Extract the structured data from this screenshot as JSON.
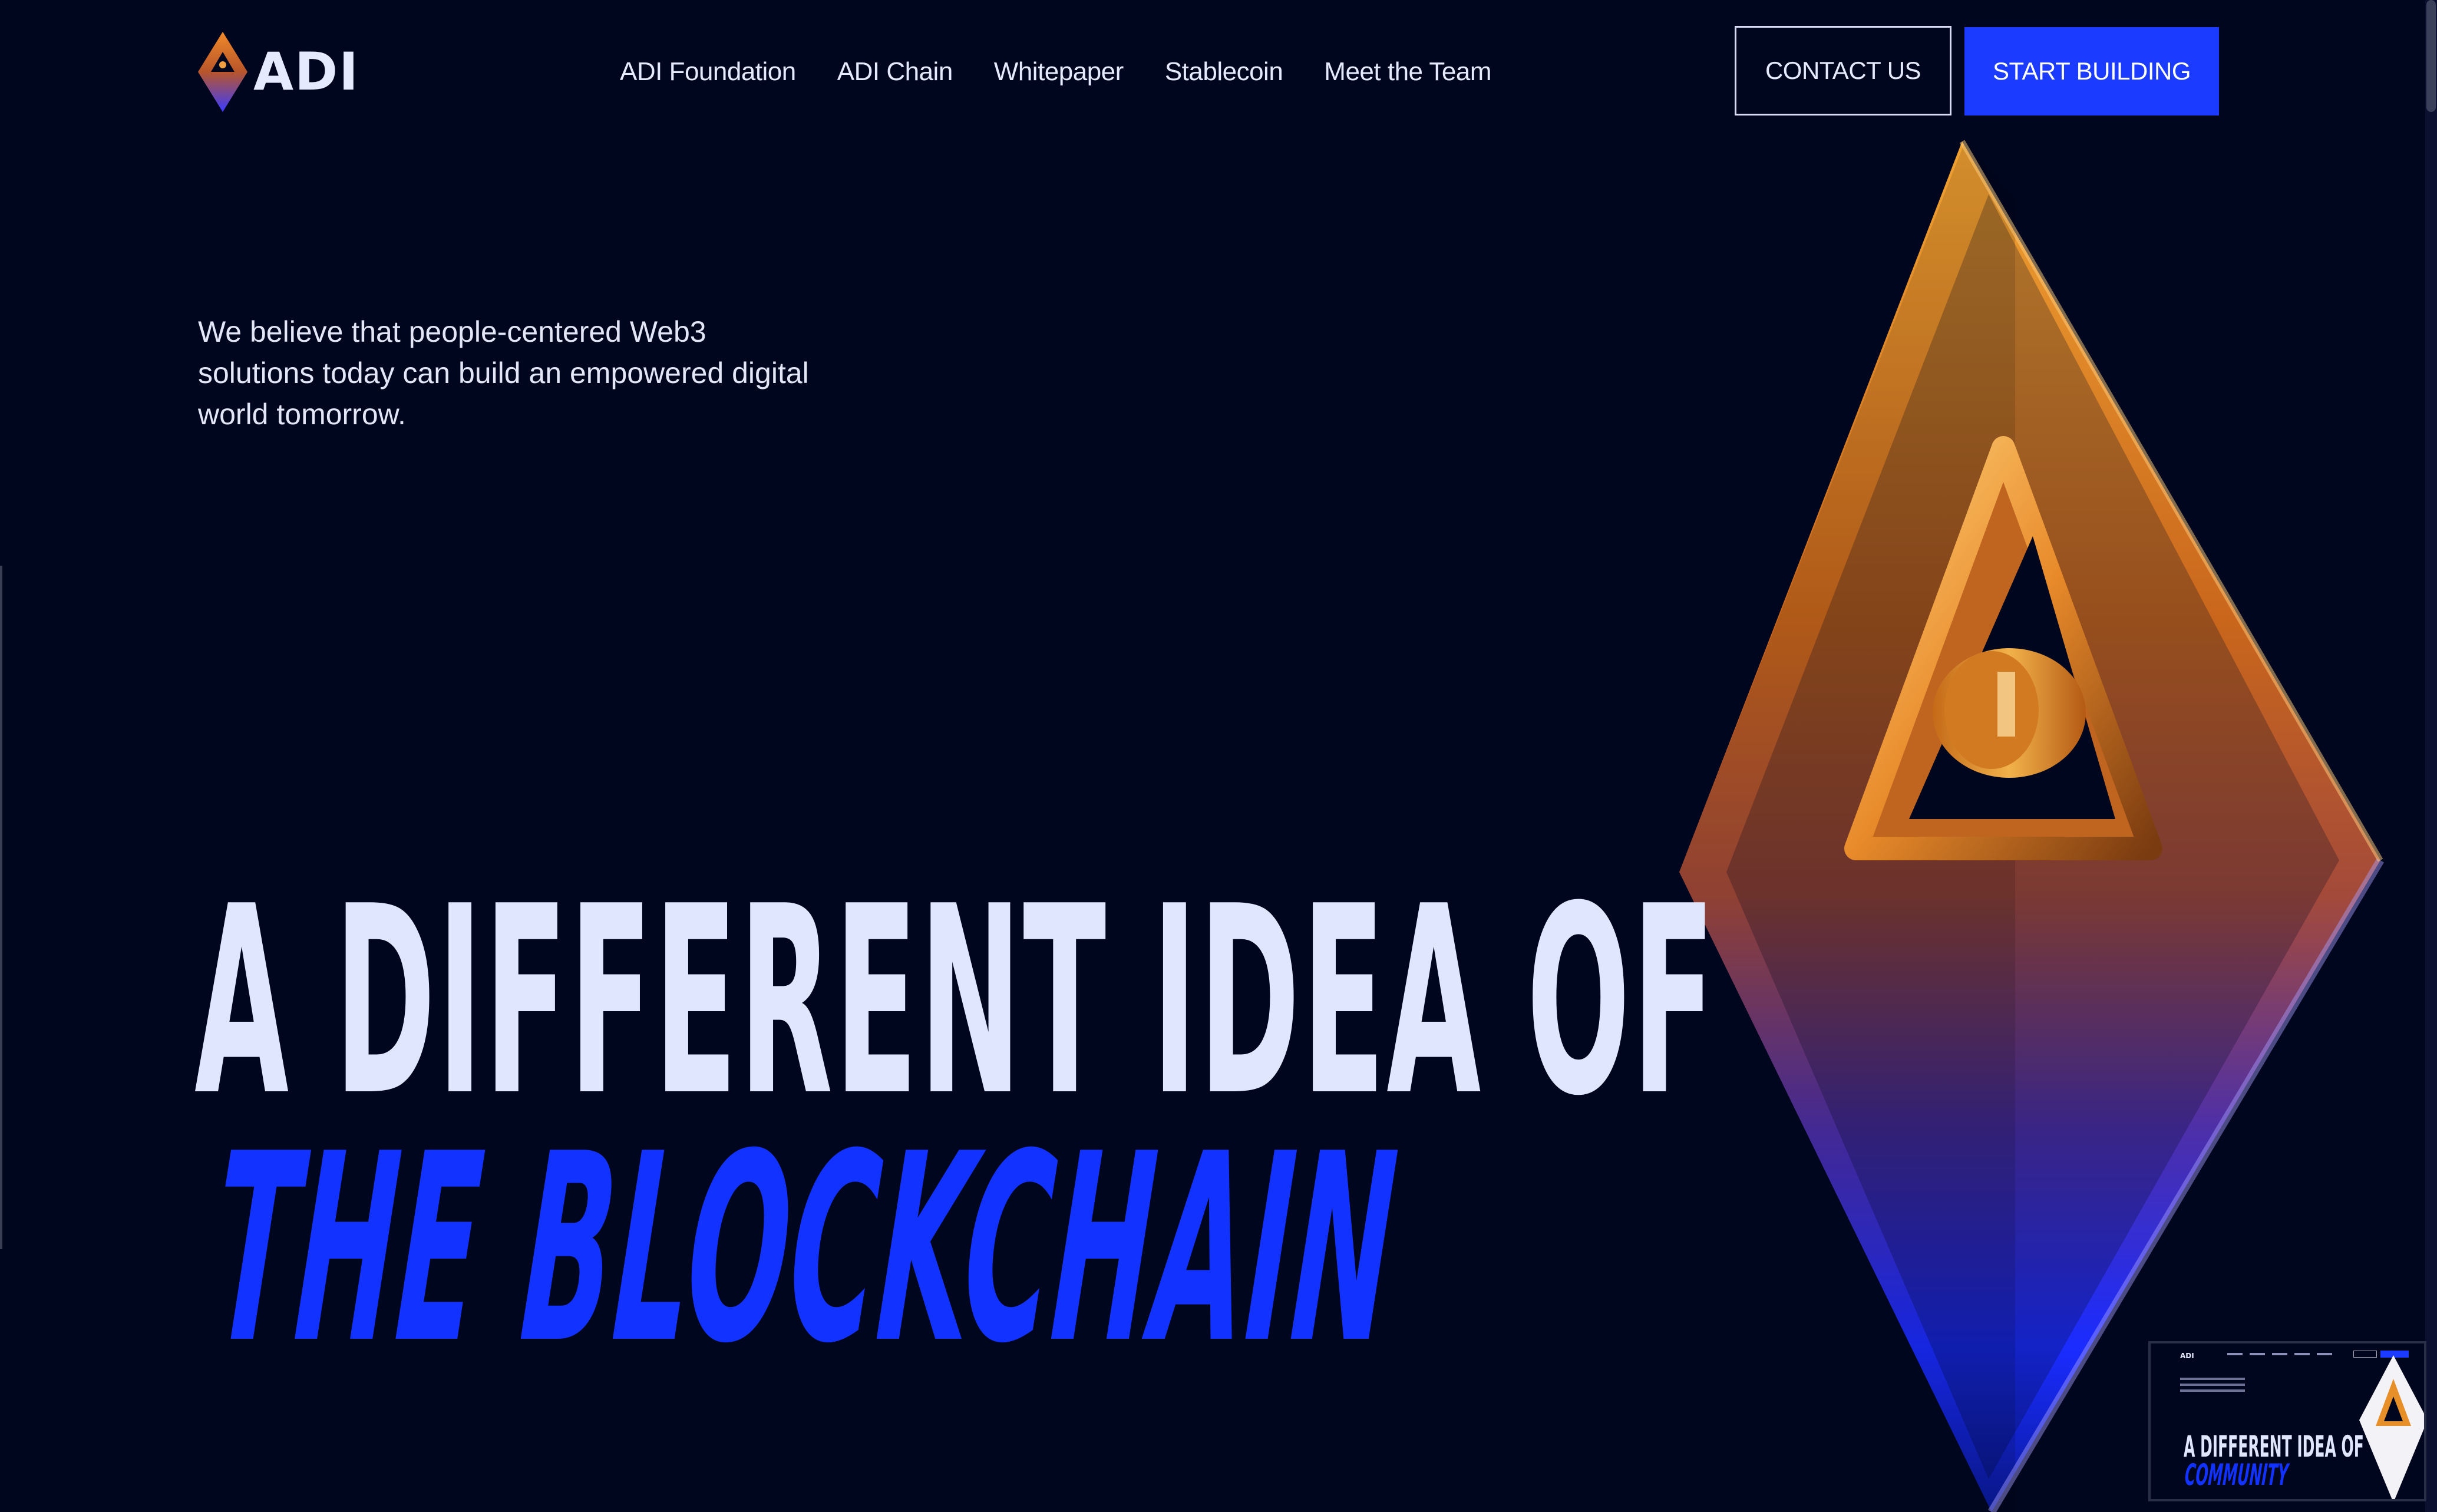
{
  "brand": {
    "logo_text": "ADI"
  },
  "nav": {
    "items": [
      "ADI Foundation",
      "ADI Chain",
      "Whitepaper",
      "Stablecoin",
      "Meet the Team"
    ]
  },
  "actions": {
    "contact_label": "CONTACT US",
    "start_label": "START BUILDING"
  },
  "hero": {
    "tagline": "We believe that people-centered Web3 solutions today can build an empowered digital world tomorrow.",
    "headline_line1": "A DIFFERENT IDEA OF",
    "headline_line2": "THE BLOCKCHAIN"
  },
  "preview": {
    "headline_line1": "A DIFFERENT IDEA OF",
    "headline_line2": "COMMUNITY"
  },
  "colors": {
    "background": "#01061f",
    "accent_blue": "#1b3cff",
    "headline_light": "#e1e6ff",
    "emblem_orange": "#e7902a"
  },
  "icons": [
    "adi-logo-icon",
    "adi-3d-emblem-icon"
  ]
}
